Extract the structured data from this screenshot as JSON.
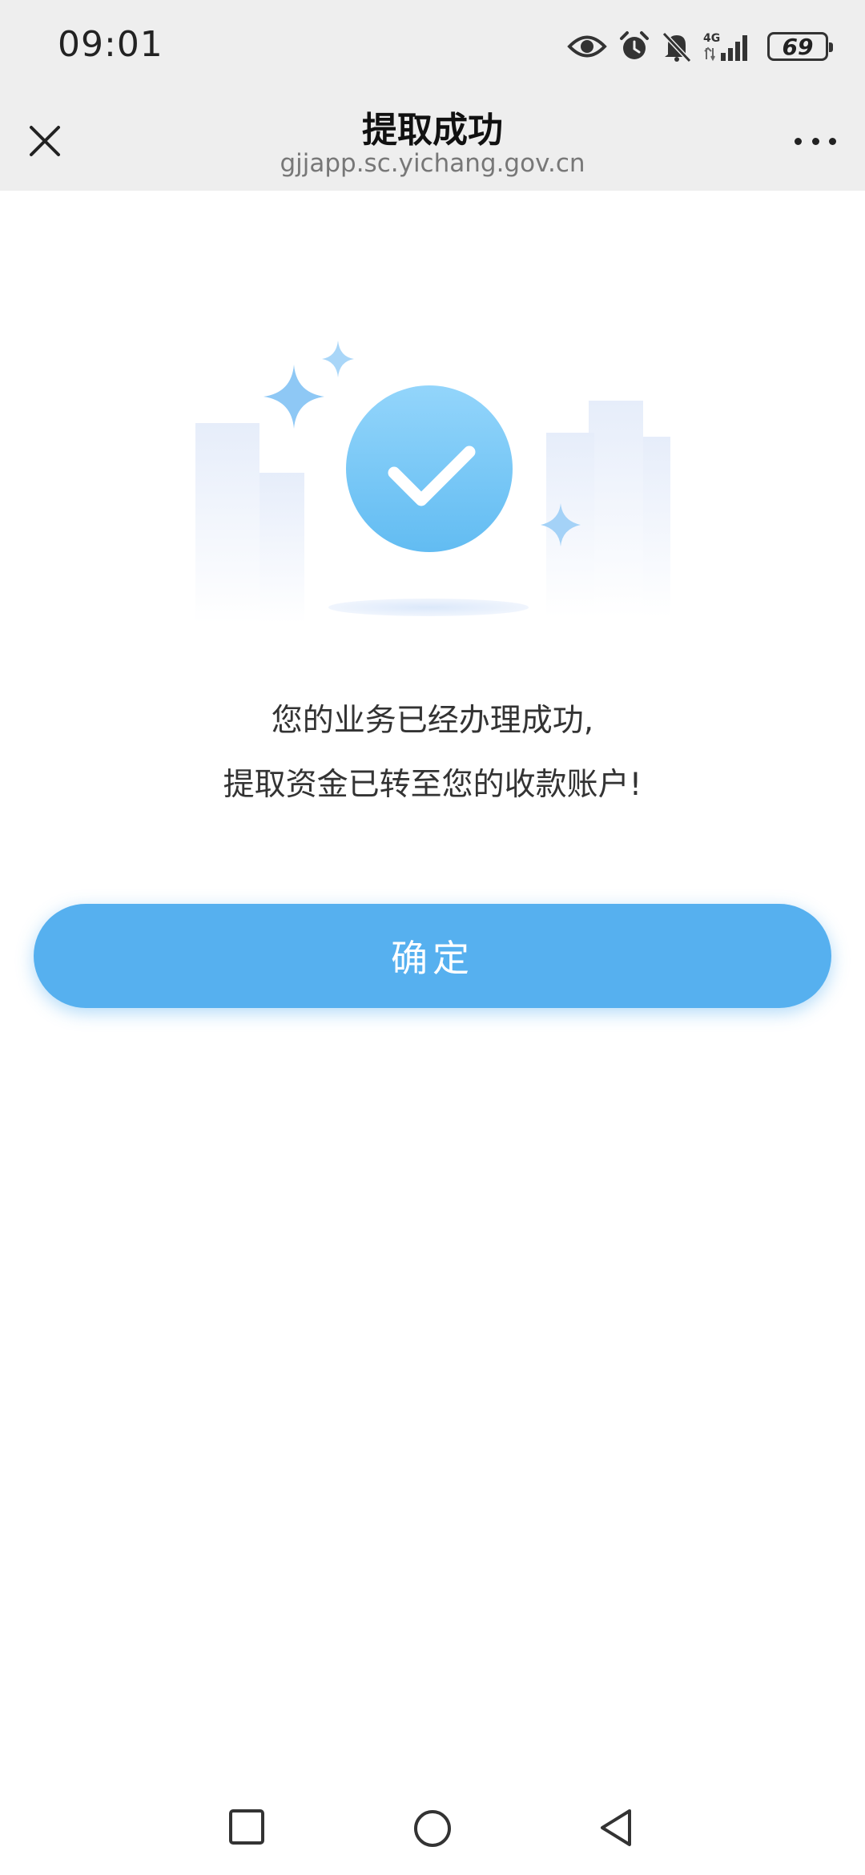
{
  "status_bar": {
    "time": "09:01",
    "network": "4G",
    "battery": "69",
    "icons": [
      "eye-icon",
      "alarm-icon",
      "bell-muted-icon",
      "signal-icon",
      "battery-icon"
    ]
  },
  "header": {
    "title": "提取成功",
    "url": "gjjapp.sc.yichang.gov.cn",
    "close_icon": "close-icon",
    "more_icon": "more-icon"
  },
  "illustration": {
    "icon": "success-check-icon",
    "accent_color": "#56b0ef"
  },
  "message": {
    "line1": "您的业务已经办理成功,",
    "line2": "提取资金已转至您的收款账户!"
  },
  "confirm_button": {
    "label": "确定",
    "color": "#56b0ef"
  },
  "system_nav": {
    "icons": [
      "recents-square-icon",
      "home-circle-icon",
      "back-triangle-icon"
    ]
  }
}
